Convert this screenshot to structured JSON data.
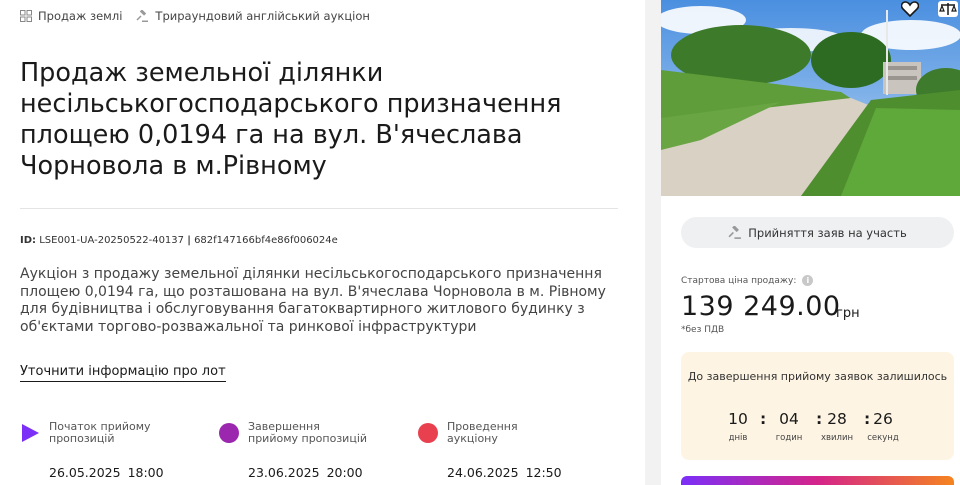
{
  "breadcrumbs": [
    {
      "label": "Продаж землі",
      "icon": "grid-icon"
    },
    {
      "label": "Трираундовий англійський аукціон",
      "icon": "gavel-icon"
    }
  ],
  "lot": {
    "title": "Продаж земельної ділянки несільськогосподарського призначення площею 0,0194 га на вул. В'ячеслава Чорновола в м.Рівному",
    "id_label": "ID:",
    "id": "LSE001-UA-20250522-40137",
    "id_separator": "|",
    "hash": "682f147166bf4e86f006024e",
    "description": "Аукціон з продажу земельної ділянки несільськогосподарського призначення площею 0,0194 га, що розташована на вул. В'ячеслава Чорновола в м. Рівному для будівництва і обслуговування багатоквартирного житлового будинку з об'єктами торгово-розважальної та ринкової інфраструктури",
    "clarify_link": "Уточнити інформацію про лот"
  },
  "stages": [
    {
      "label": "Початок прийому пропозицій",
      "date": "26.05.2025",
      "time": "18:00",
      "color": "#7b2ff7",
      "shape": "play-icon"
    },
    {
      "label": "Завершення прийому пропозицій",
      "date": "23.06.2025",
      "time": "20:00",
      "color": "#9b27af",
      "shape": "circle-icon"
    },
    {
      "label": "Проведення аукціону",
      "date": "24.06.2025",
      "time": "12:50",
      "color": "#e8404f",
      "shape": "circle-icon"
    }
  ],
  "sidebar": {
    "icons": [
      "heart-icon",
      "scales-icon"
    ],
    "status_button": "Прийняття заяв на участь",
    "price_label": "Стартова ціна продажу:",
    "price": "139 249.00",
    "currency": "грн",
    "vat_note": "*без ПДВ",
    "timer": {
      "title": "До завершення прийому заявок залишилось",
      "units": [
        {
          "value": "10",
          "label": "днів"
        },
        {
          "value": "04",
          "label": "годин"
        },
        {
          "value": "28",
          "label": "хвилин"
        },
        {
          "value": "26",
          "label": "секунд"
        }
      ],
      "separator": ":"
    }
  },
  "colors": {
    "accent_purple": "#7b2ff7",
    "timer_bg": "#fdf4e3",
    "status_bg": "#eef0f2"
  }
}
